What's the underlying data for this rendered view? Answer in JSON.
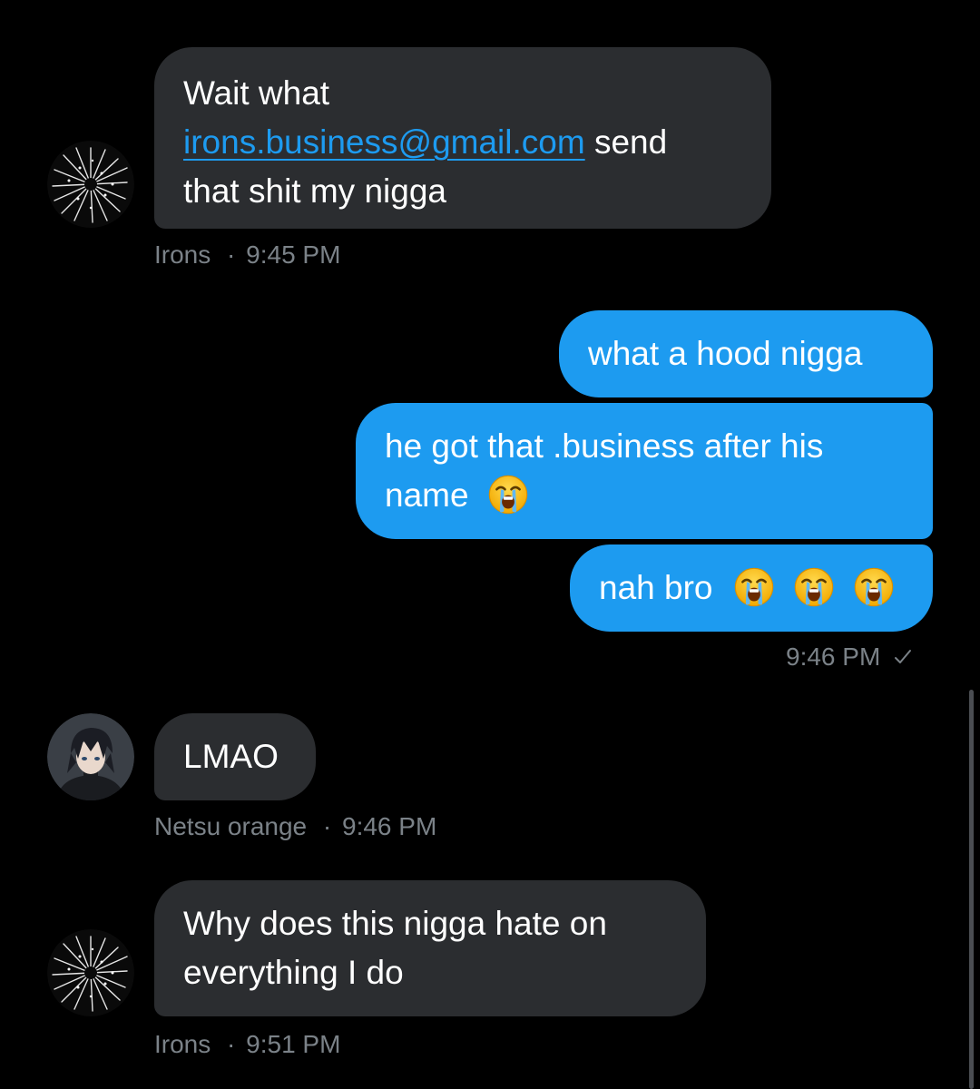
{
  "messages": [
    {
      "sender": "Irons",
      "time": "9:45 PM",
      "lines": [
        "Wait what",
        "irons.business@gmail.com",
        "send",
        "that shit my nigga"
      ]
    },
    {
      "text": "what a hood nigga"
    },
    {
      "lines": [
        "he got that .business after his",
        "name"
      ]
    },
    {
      "text": "nah bro"
    },
    {
      "text": "LMAO",
      "sender": "Netsu orange",
      "time": "9:46 PM"
    },
    {
      "sender": "Irons",
      "time": "9:51 PM",
      "lines": [
        "Why does this nigga hate on",
        "everything I do"
      ]
    }
  ],
  "outgoing_meta": {
    "time": "9:46 PM"
  },
  "separator": "·",
  "icons": {
    "emoji": "loudly-crying-face-icon",
    "read_receipt": "checkmark-icon",
    "avatar_irons": "abstract-burst-avatar",
    "avatar_netsu": "anime-character-avatar"
  },
  "colors": {
    "background": "#000000",
    "incoming_bubble": "#2b2d30",
    "outgoing_bubble": "#1d9bf0",
    "link": "#1d9bf0",
    "meta_text": "#7b8288"
  }
}
